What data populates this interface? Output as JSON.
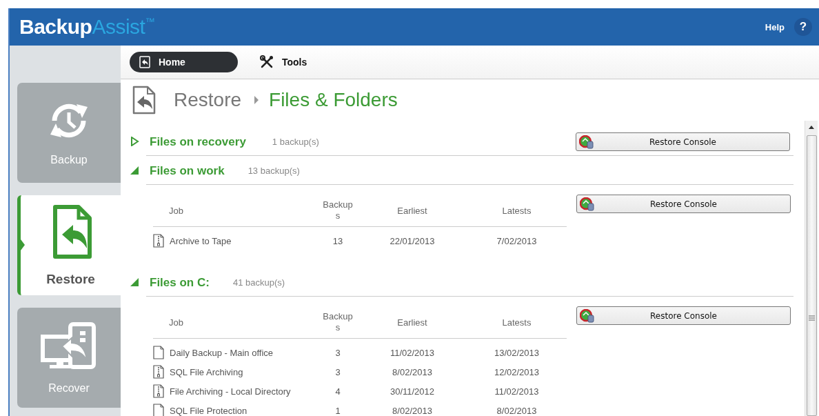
{
  "app": {
    "brand_primary": "Backup",
    "brand_secondary": "Assist",
    "trademark": "™",
    "help": "Help",
    "help_icon": "?"
  },
  "sidebar": {
    "items": [
      {
        "label": "Backup",
        "kind": "backup",
        "selected": false
      },
      {
        "label": "Restore",
        "kind": "restore",
        "selected": true
      },
      {
        "label": "Recover",
        "kind": "recover",
        "selected": false
      }
    ]
  },
  "toolbar": {
    "tabs": [
      {
        "label": "Home",
        "kind": "home",
        "selected": true
      },
      {
        "label": "Tools",
        "kind": "tools",
        "selected": false
      }
    ]
  },
  "breadcrumb": {
    "parent": "Restore",
    "current": "Files & Folders"
  },
  "sections": [
    {
      "title": "Files on recovery",
      "count": "1 backup(s)",
      "expanded": false,
      "button": "Restore Console"
    },
    {
      "title": "Files on work",
      "count": "13 backup(s)",
      "expanded": true,
      "button": "Restore Console",
      "table": {
        "columns": [
          "Job",
          "Backups",
          "Earliest",
          "Latests"
        ],
        "rows": [
          {
            "kind": "zip",
            "cells": [
              "Archive to Tape",
              "13",
              "22/01/2013",
              "7/02/2013"
            ]
          }
        ]
      }
    },
    {
      "title": "Files on C:",
      "count": "41 backup(s)",
      "expanded": true,
      "button": "Restore Console",
      "table": {
        "columns": [
          "Job",
          "Backups",
          "Earliest",
          "Latests"
        ],
        "rows": [
          {
            "kind": "plain",
            "cells": [
              "Daily Backup - Main office",
              "3",
              "11/02/2013",
              "13/02/2013"
            ]
          },
          {
            "kind": "zip",
            "cells": [
              "SQL File Archiving",
              "3",
              "8/02/2013",
              "12/02/2013"
            ]
          },
          {
            "kind": "zip",
            "cells": [
              "File Archiving - Local Directory",
              "4",
              "30/11/2012",
              "11/02/2013"
            ]
          },
          {
            "kind": "plain",
            "cells": [
              "SQL File Protection",
              "1",
              "8/02/2013",
              "8/02/2013"
            ]
          }
        ]
      }
    }
  ]
}
